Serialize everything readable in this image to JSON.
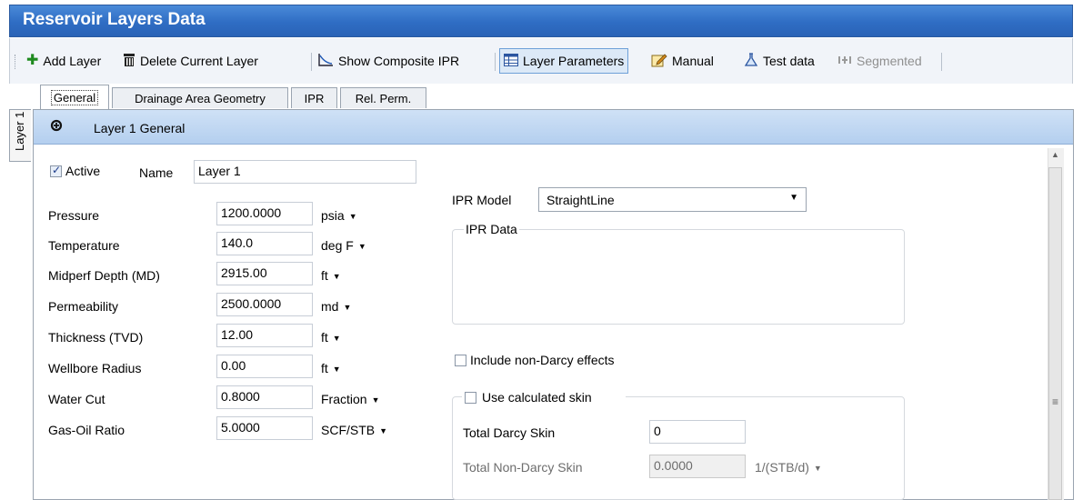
{
  "window": {
    "title": "Reservoir Layers Data"
  },
  "toolbar": {
    "add_layer": "Add Layer",
    "delete_layer": "Delete Current Layer",
    "show_composite_ipr": "Show Composite IPR",
    "layer_parameters": "Layer Parameters",
    "manual": "Manual",
    "test_data": "Test data",
    "segmented": "Segmented"
  },
  "layer_tab": {
    "label": "Layer 1"
  },
  "tabs": [
    {
      "label": "General",
      "active": true
    },
    {
      "label": "Drainage Area Geometry",
      "active": false
    },
    {
      "label": "IPR",
      "active": false
    },
    {
      "label": "Rel. Perm.",
      "active": false
    }
  ],
  "section": {
    "title": "Layer 1 General"
  },
  "general": {
    "active_label": "Active",
    "active_checked": true,
    "name_label": "Name",
    "name_value": "Layer 1",
    "fields": [
      {
        "label": "Pressure",
        "value": "1200.0000",
        "unit": "psia"
      },
      {
        "label": "Temperature",
        "value": "140.0",
        "unit": "deg F"
      },
      {
        "label": "Midperf Depth (MD)",
        "value": "2915.00",
        "unit": "ft"
      },
      {
        "label": "Permeability",
        "value": "2500.0000",
        "unit": "md"
      },
      {
        "label": "Thickness (TVD)",
        "value": "12.00",
        "unit": "ft"
      },
      {
        "label": "Wellbore Radius",
        "value": "0.00",
        "unit": "ft"
      },
      {
        "label": "Water Cut",
        "value": "0.8000",
        "unit": "Fraction"
      },
      {
        "label": "Gas-Oil Ratio",
        "value": "5.0000",
        "unit": "SCF/STB"
      }
    ]
  },
  "ipr": {
    "model_label": "IPR Model",
    "model_value": "StraightLine",
    "data_group_label": "IPR Data",
    "non_darcy_label": "Include non-Darcy effects",
    "non_darcy_checked": false,
    "calc_skin_label": "Use calculated skin",
    "calc_skin_checked": false,
    "total_darcy_skin_label": "Total Darcy Skin",
    "total_darcy_skin_value": "0",
    "total_non_darcy_skin_label": "Total Non-Darcy Skin",
    "total_non_darcy_skin_value": "0.0000",
    "total_non_darcy_skin_unit": "1/(STB/d)"
  },
  "colors": {
    "title_bar": "#2f6dc4",
    "section_header": "#c3d9f3",
    "add_icon": "#1f8a1f",
    "selected_button": "#dce9f7"
  },
  "icons": {
    "add": "plus-icon",
    "delete": "trash-icon",
    "composite_ipr": "curve-chart-icon",
    "layer_parameters": "table-icon",
    "manual": "edit-icon",
    "test_data": "flask-icon",
    "segmented": "segments-icon"
  }
}
